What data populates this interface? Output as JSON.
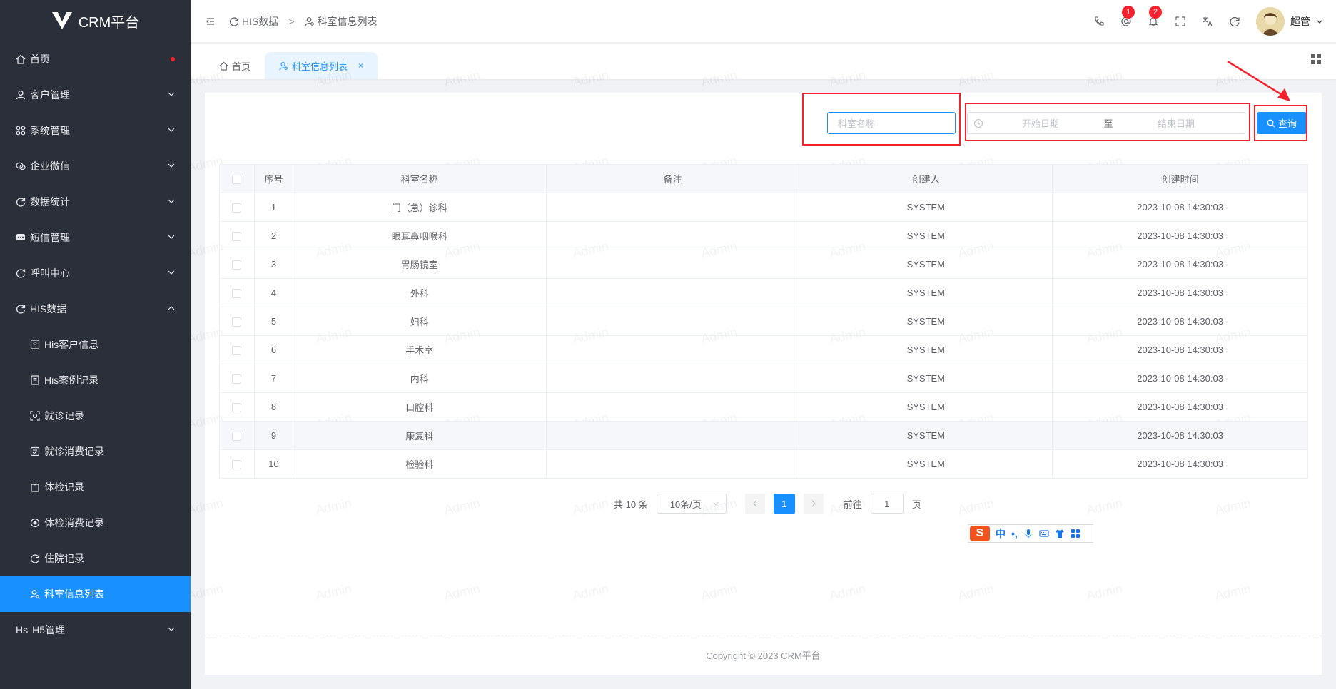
{
  "app": {
    "name": "CRM平台"
  },
  "sidebar": {
    "items": [
      {
        "label": "首页",
        "icon": "home-icon"
      },
      {
        "label": "客户管理",
        "icon": "user-icon"
      },
      {
        "label": "系统管理",
        "icon": "apps-icon"
      },
      {
        "label": "企业微信",
        "icon": "wechat-icon"
      },
      {
        "label": "数据统计",
        "icon": "refresh-icon"
      },
      {
        "label": "短信管理",
        "icon": "message-icon"
      },
      {
        "label": "呼叫中心",
        "icon": "refresh-icon"
      },
      {
        "label": "HIS数据",
        "icon": "refresh-icon"
      }
    ],
    "sub_items": [
      {
        "label": "His客户信息"
      },
      {
        "label": "His案例记录"
      },
      {
        "label": "就诊记录"
      },
      {
        "label": "就诊消费记录"
      },
      {
        "label": "体检记录"
      },
      {
        "label": "体检消费记录"
      },
      {
        "label": "住院记录"
      },
      {
        "label": "科室信息列表"
      }
    ],
    "last_item": {
      "prefix": "Hs",
      "label": "H5管理"
    }
  },
  "header": {
    "breadcrumb": [
      "HIS数据",
      "科室信息列表"
    ],
    "breadcrumb_sep": ">",
    "mention_badge": "1",
    "bell_badge": "2",
    "user_name": "超管"
  },
  "tabs": [
    {
      "label": "首页"
    },
    {
      "label": "科室信息列表",
      "close": "×"
    }
  ],
  "watermark": "Admin",
  "search": {
    "dept_placeholder": "科室名称",
    "start_placeholder": "开始日期",
    "range_sep": "至",
    "end_placeholder": "结束日期",
    "query_label": "查询"
  },
  "table": {
    "columns": [
      "序号",
      "科室名称",
      "备注",
      "创建人",
      "创建时间"
    ],
    "rows": [
      {
        "no": "1",
        "name": "门（急）诊科",
        "remark": "",
        "creator": "SYSTEM",
        "time": "2023-10-08 14:30:03"
      },
      {
        "no": "2",
        "name": "眼耳鼻咽喉科",
        "remark": "",
        "creator": "SYSTEM",
        "time": "2023-10-08 14:30:03"
      },
      {
        "no": "3",
        "name": "胃肠镜室",
        "remark": "",
        "creator": "SYSTEM",
        "time": "2023-10-08 14:30:03"
      },
      {
        "no": "4",
        "name": "外科",
        "remark": "",
        "creator": "SYSTEM",
        "time": "2023-10-08 14:30:03"
      },
      {
        "no": "5",
        "name": "妇科",
        "remark": "",
        "creator": "SYSTEM",
        "time": "2023-10-08 14:30:03"
      },
      {
        "no": "6",
        "name": "手术室",
        "remark": "",
        "creator": "SYSTEM",
        "time": "2023-10-08 14:30:03"
      },
      {
        "no": "7",
        "name": "内科",
        "remark": "",
        "creator": "SYSTEM",
        "time": "2023-10-08 14:30:03"
      },
      {
        "no": "8",
        "name": "口腔科",
        "remark": "",
        "creator": "SYSTEM",
        "time": "2023-10-08 14:30:03"
      },
      {
        "no": "9",
        "name": "康复科",
        "remark": "",
        "creator": "SYSTEM",
        "time": "2023-10-08 14:30:03"
      },
      {
        "no": "10",
        "name": "检验科",
        "remark": "",
        "creator": "SYSTEM",
        "time": "2023-10-08 14:30:03"
      }
    ]
  },
  "pagination": {
    "total": "共 10 条",
    "page_size": "10条/页",
    "current": "1",
    "goto_label": "前往",
    "goto_value": "1",
    "page_suffix": "页"
  },
  "ime": {
    "logo": "S",
    "lang": "中",
    "punct": "•,"
  },
  "footer": {
    "copyright": "Copyright © 2023 CRM平台"
  },
  "colors": {
    "primary": "#1890ff",
    "sidebar": "#2a2f3a",
    "annotation": "#f5222d"
  }
}
